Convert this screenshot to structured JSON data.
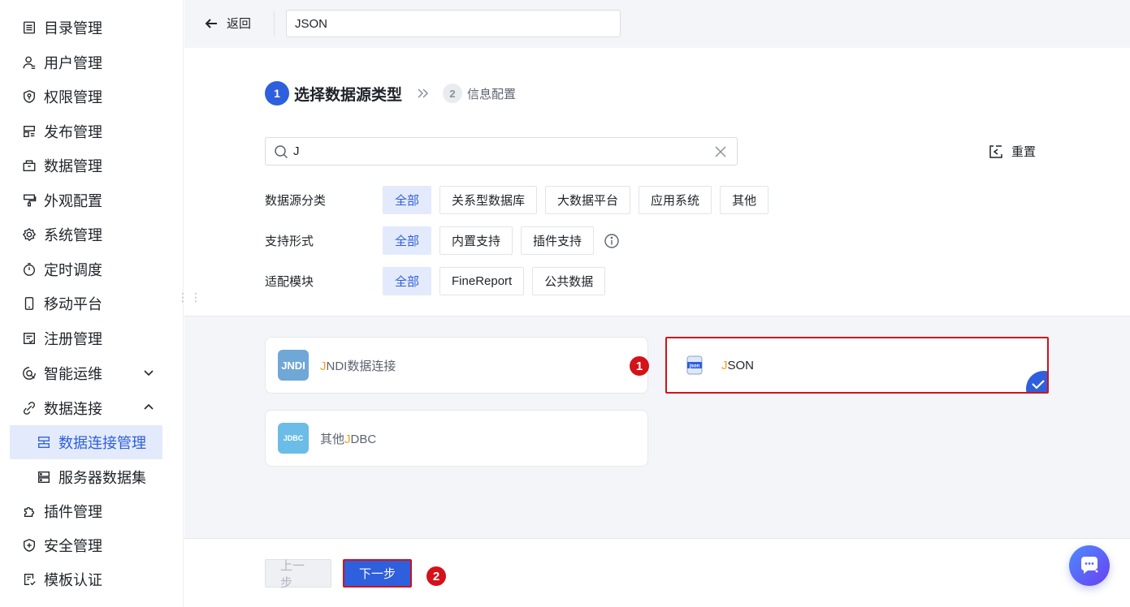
{
  "sidebar": {
    "items": [
      {
        "label": "目录管理",
        "icon": "catalog-icon"
      },
      {
        "label": "用户管理",
        "icon": "user-icon"
      },
      {
        "label": "权限管理",
        "icon": "shield-icon"
      },
      {
        "label": "发布管理",
        "icon": "publish-icon"
      },
      {
        "label": "数据管理",
        "icon": "data-icon"
      },
      {
        "label": "外观配置",
        "icon": "paint-icon"
      },
      {
        "label": "系统管理",
        "icon": "gear-icon"
      },
      {
        "label": "定时调度",
        "icon": "timer-icon"
      },
      {
        "label": "移动平台",
        "icon": "mobile-icon"
      },
      {
        "label": "注册管理",
        "icon": "register-icon"
      },
      {
        "label": "智能运维",
        "icon": "ops-icon"
      },
      {
        "label": "数据连接",
        "icon": "link-icon"
      },
      {
        "label": "数据连接管理",
        "icon": "connection-icon"
      },
      {
        "label": "服务器数据集",
        "icon": "server-dataset-icon"
      },
      {
        "label": "插件管理",
        "icon": "plugin-icon"
      },
      {
        "label": "安全管理",
        "icon": "security-icon"
      },
      {
        "label": "模板认证",
        "icon": "template-icon"
      }
    ]
  },
  "topbar": {
    "back_label": "返回",
    "name_value": "JSON"
  },
  "steps": {
    "step1_num": "1",
    "step1_title": "选择数据源类型",
    "step2_num": "2",
    "step2_title": "信息配置"
  },
  "search": {
    "value": "J"
  },
  "reset_label": "重置",
  "filters": {
    "category": {
      "label": "数据源分类",
      "options": [
        "全部",
        "关系型数据库",
        "大数据平台",
        "应用系统",
        "其他"
      ],
      "selected": "全部"
    },
    "support": {
      "label": "支持形式",
      "options": [
        "全部",
        "内置支持",
        "插件支持"
      ],
      "selected": "全部"
    },
    "module": {
      "label": "适配模块",
      "options": [
        "全部",
        "FineReport",
        "公共数据"
      ],
      "selected": "全部"
    }
  },
  "cards": [
    {
      "logo_text": "JNDI",
      "hl": "J",
      "rest": "NDI数据连接",
      "logo_color": "#6fa7d6"
    },
    {
      "logo_text": "json",
      "hl": "J",
      "rest": "SON",
      "logo_color": "#2e5fdc",
      "selected": true
    },
    {
      "logo_text": "JDBC",
      "hl": "J",
      "rest": "DBC",
      "prefix": "其他",
      "logo_color": "#6cbce8"
    }
  ],
  "badges": {
    "one": "1",
    "two": "2"
  },
  "footer": {
    "prev_label": "上一步",
    "next_label": "下一步"
  },
  "colors": {
    "accent": "#2e5fdc",
    "highlight": "#f0a020",
    "annotation": "#d3121a"
  }
}
